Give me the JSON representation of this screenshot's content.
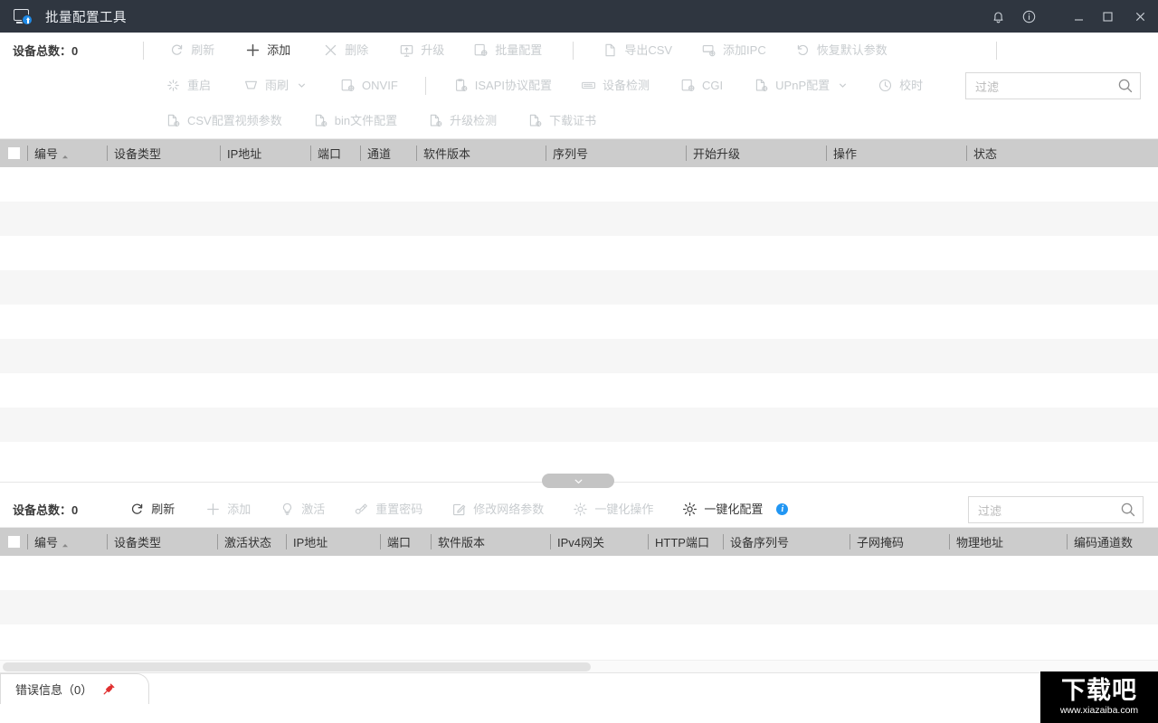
{
  "window": {
    "title": "批量配置工具",
    "logo_icon": "device-upgrade-icon",
    "controls": {
      "notification_icon": "bell-icon",
      "info_icon": "info-circle-icon",
      "minimize_icon": "minimize-icon",
      "maximize_icon": "maximize-icon",
      "close_icon": "close-icon"
    }
  },
  "upper": {
    "device_count_label": "设备总数：0",
    "toolbar_rows": [
      [
        {
          "label": "刷新",
          "icon": "refresh-icon",
          "enabled": false
        },
        {
          "label": "添加",
          "icon": "plus-icon",
          "enabled": true
        },
        {
          "label": "删除",
          "icon": "close-x-icon",
          "enabled": false
        },
        {
          "label": "升级",
          "icon": "upgrade-monitor-icon",
          "enabled": false
        },
        {
          "label": "批量配置",
          "icon": "batch-config-icon",
          "enabled": false
        },
        {
          "label": "导出CSV",
          "icon": "export-csv-icon",
          "enabled": false
        },
        {
          "label": "添加IPC",
          "icon": "add-ipc-icon",
          "enabled": false
        },
        {
          "label": "恢复默认参数",
          "icon": "restore-default-icon",
          "enabled": false
        }
      ],
      [
        {
          "label": "重启",
          "icon": "reboot-icon",
          "enabled": false
        },
        {
          "label": "雨刷",
          "icon": "wiper-icon",
          "enabled": false,
          "dropdown": true
        },
        {
          "label": "ONVIF",
          "icon": "onvif-icon",
          "enabled": false
        },
        {
          "label": "ISAPI协议配置",
          "icon": "isapi-icon",
          "enabled": false
        },
        {
          "label": "设备检测",
          "icon": "device-detect-icon",
          "enabled": false
        },
        {
          "label": "CGI",
          "icon": "cgi-icon",
          "enabled": false
        },
        {
          "label": "UPnP配置",
          "icon": "upnp-icon",
          "enabled": false,
          "dropdown": true
        },
        {
          "label": "校时",
          "icon": "clock-icon",
          "enabled": false
        }
      ],
      [
        {
          "label": "CSV配置视频参数",
          "icon": "csv-video-icon",
          "enabled": false
        },
        {
          "label": "bin文件配置",
          "icon": "bin-file-icon",
          "enabled": false
        },
        {
          "label": "升级检测",
          "icon": "upgrade-check-icon",
          "enabled": false
        },
        {
          "label": "下载证书",
          "icon": "download-cert-icon",
          "enabled": false
        }
      ]
    ],
    "filter": {
      "placeholder": "过滤",
      "value": "",
      "icon": "search-icon"
    },
    "table": {
      "select_all_checkbox": "",
      "columns": [
        "编号",
        "设备类型",
        "IP地址",
        "端口",
        "通道",
        "软件版本",
        "序列号",
        "开始升级",
        "操作",
        "状态"
      ],
      "sorted_column": "编号",
      "sort_direction": "asc",
      "rows": []
    }
  },
  "collapse_handle": {
    "icon": "chevron-down-icon"
  },
  "lower": {
    "device_count_label": "设备总数：0",
    "toolbar": [
      {
        "label": "刷新",
        "icon": "refresh-icon",
        "enabled": true
      },
      {
        "label": "添加",
        "icon": "plus-icon",
        "enabled": false
      },
      {
        "label": "激活",
        "icon": "activate-bulb-icon",
        "enabled": false
      },
      {
        "label": "重置密码",
        "icon": "reset-password-icon",
        "enabled": false
      },
      {
        "label": "修改网络参数",
        "icon": "edit-network-icon",
        "enabled": false
      },
      {
        "label": "一键化操作",
        "icon": "gear-icon",
        "enabled": false
      },
      {
        "label": "一键化配置",
        "icon": "gear-icon",
        "enabled": true,
        "info_badge": "i"
      }
    ],
    "filter": {
      "placeholder": "过滤",
      "value": "",
      "icon": "search-icon"
    },
    "table": {
      "select_all_checkbox": "",
      "columns": [
        "编号",
        "设备类型",
        "激活状态",
        "IP地址",
        "端口",
        "软件版本",
        "IPv4网关",
        "HTTP端口",
        "设备序列号",
        "子网掩码",
        "物理地址",
        "编码通道数"
      ],
      "sorted_column": "编号",
      "sort_direction": "asc",
      "rows": []
    }
  },
  "status": {
    "error_tab_label": "错误信息（0）",
    "pin_icon": "pin-icon"
  },
  "watermark": {
    "text": "下载吧",
    "url": "www.xiazaiba.com"
  },
  "colors": {
    "titlebar_bg": "#2f3640",
    "accent": "#2196f3",
    "header_bg": "#cccccc",
    "disabled_text": "#c8cccf",
    "enabled_text": "#3b3b3b"
  }
}
